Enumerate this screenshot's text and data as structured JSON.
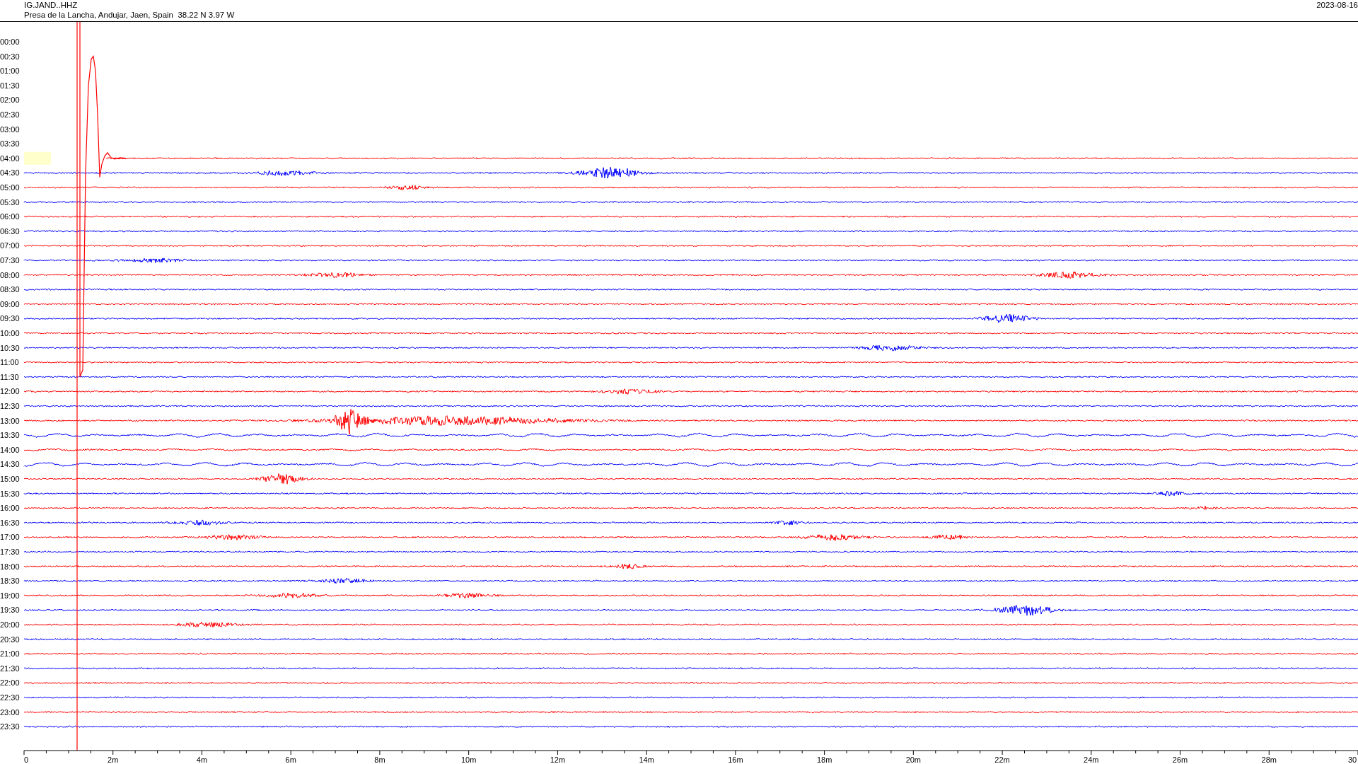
{
  "header": {
    "station": "IG.JAND..HHZ",
    "location": "Presa de la Lancha, Andujar, Jaen, Spain  38.22 N 3.97 W",
    "date": "2023-08-16"
  },
  "rows": [
    {
      "time": "00:00",
      "recorded": false,
      "highlighted": false
    },
    {
      "time": "00:30",
      "recorded": false,
      "highlighted": false
    },
    {
      "time": "01:00",
      "recorded": false,
      "highlighted": false
    },
    {
      "time": "01:30",
      "recorded": false,
      "highlighted": false
    },
    {
      "time": "02:00",
      "recorded": false,
      "highlighted": false
    },
    {
      "time": "02:30",
      "recorded": false,
      "highlighted": false
    },
    {
      "time": "03:00",
      "recorded": false,
      "highlighted": false
    },
    {
      "time": "03:30",
      "recorded": false,
      "highlighted": false
    },
    {
      "time": "04:00",
      "color": "#ff0000",
      "recorded": true,
      "highlighted": true
    },
    {
      "time": "04:30",
      "color": "#0000ff",
      "recorded": true,
      "highlighted": false
    },
    {
      "time": "05:00",
      "color": "#ff0000",
      "recorded": true,
      "highlighted": false
    },
    {
      "time": "05:30",
      "color": "#0000ff",
      "recorded": true,
      "highlighted": false
    },
    {
      "time": "06:00",
      "color": "#ff0000",
      "recorded": true,
      "highlighted": false
    },
    {
      "time": "06:30",
      "color": "#0000ff",
      "recorded": true,
      "highlighted": false
    },
    {
      "time": "07:00",
      "color": "#ff0000",
      "recorded": true,
      "highlighted": false
    },
    {
      "time": "07:30",
      "color": "#0000ff",
      "recorded": true,
      "highlighted": false
    },
    {
      "time": "08:00",
      "color": "#ff0000",
      "recorded": true,
      "highlighted": false
    },
    {
      "time": "08:30",
      "color": "#0000ff",
      "recorded": true,
      "highlighted": false
    },
    {
      "time": "09:00",
      "color": "#ff0000",
      "recorded": true,
      "highlighted": false
    },
    {
      "time": "09:30",
      "color": "#0000ff",
      "recorded": true,
      "highlighted": false
    },
    {
      "time": "10:00",
      "color": "#ff0000",
      "recorded": true,
      "highlighted": false
    },
    {
      "time": "10:30",
      "color": "#0000ff",
      "recorded": true,
      "highlighted": false
    },
    {
      "time": "11:00",
      "color": "#ff0000",
      "recorded": true,
      "highlighted": false
    },
    {
      "time": "11:30",
      "color": "#0000ff",
      "recorded": true,
      "highlighted": false
    },
    {
      "time": "12:00",
      "color": "#ff0000",
      "recorded": true,
      "highlighted": false
    },
    {
      "time": "12:30",
      "color": "#0000ff",
      "recorded": true,
      "highlighted": false
    },
    {
      "time": "13:00",
      "color": "#ff0000",
      "recorded": true,
      "highlighted": false
    },
    {
      "time": "13:30",
      "color": "#0000ff",
      "recorded": true,
      "highlighted": false
    },
    {
      "time": "14:00",
      "color": "#ff0000",
      "recorded": true,
      "highlighted": false
    },
    {
      "time": "14:30",
      "color": "#0000ff",
      "recorded": true,
      "highlighted": false
    },
    {
      "time": "15:00",
      "color": "#ff0000",
      "recorded": true,
      "highlighted": false
    },
    {
      "time": "15:30",
      "color": "#0000ff",
      "recorded": true,
      "highlighted": false
    },
    {
      "time": "16:00",
      "color": "#ff0000",
      "recorded": true,
      "highlighted": false
    },
    {
      "time": "16:30",
      "color": "#0000ff",
      "recorded": true,
      "highlighted": false
    },
    {
      "time": "17:00",
      "color": "#ff0000",
      "recorded": true,
      "highlighted": false
    },
    {
      "time": "17:30",
      "color": "#0000ff",
      "recorded": true,
      "highlighted": false
    },
    {
      "time": "18:00",
      "color": "#ff0000",
      "recorded": true,
      "highlighted": false
    },
    {
      "time": "18:30",
      "color": "#0000ff",
      "recorded": true,
      "highlighted": false
    },
    {
      "time": "19:00",
      "color": "#ff0000",
      "recorded": true,
      "highlighted": false
    },
    {
      "time": "19:30",
      "color": "#0000ff",
      "recorded": true,
      "highlighted": false
    },
    {
      "time": "20:00",
      "color": "#ff0000",
      "recorded": true,
      "highlighted": false
    },
    {
      "time": "20:30",
      "color": "#0000ff",
      "recorded": true,
      "highlighted": false
    },
    {
      "time": "21:00",
      "color": "#ff0000",
      "recorded": true,
      "highlighted": false
    },
    {
      "time": "21:30",
      "color": "#0000ff",
      "recorded": true,
      "highlighted": false
    },
    {
      "time": "22:00",
      "color": "#ff0000",
      "recorded": true,
      "highlighted": false
    },
    {
      "time": "22:30",
      "color": "#0000ff",
      "recorded": true,
      "highlighted": false
    },
    {
      "time": "23:00",
      "color": "#ff0000",
      "recorded": true,
      "highlighted": false
    },
    {
      "time": "23:30",
      "color": "#0000ff",
      "recorded": true,
      "highlighted": false
    }
  ],
  "x_axis": {
    "labels": [
      "0",
      "2m",
      "4m",
      "6m",
      "8m",
      "10m",
      "12m",
      "14m",
      "16m",
      "18m",
      "20m",
      "22m",
      "24m",
      "26m",
      "28m",
      "30"
    ]
  }
}
